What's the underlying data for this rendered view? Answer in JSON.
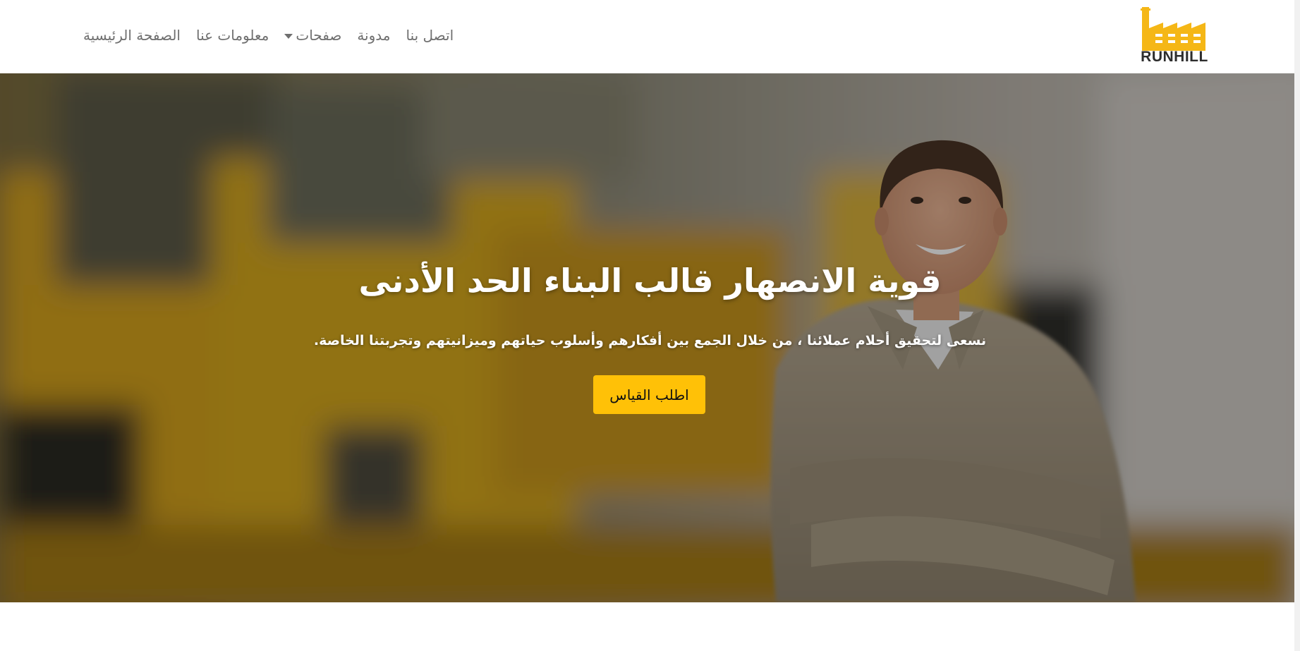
{
  "header": {
    "logo": {
      "text": "RUNHILL",
      "icon": "factory-icon",
      "color": "#f5b716"
    },
    "nav": {
      "home": "الصفحة الرئيسية",
      "about": "معلومات عنا",
      "pages": "صفحات",
      "blog": "مدونة",
      "contact": "اتصل بنا"
    }
  },
  "hero": {
    "title": "قوية الانصهار قالب البناء الحد الأدنى",
    "subtitle": "نسعى لتحقيق أحلام عملائنا ، من خلال الجمع بين أفكارهم وأسلوب حياتهم وميزانيتهم وتجربتنا الخاصة.",
    "cta_label": "اطلب القياس",
    "cta_color": "#ffc107",
    "background_image": "blurred-excavator-with-smiling-worker"
  }
}
